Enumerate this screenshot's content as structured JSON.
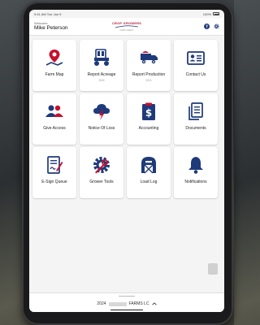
{
  "status_bar": {
    "time": "9:41 AM  Tue Jan 9",
    "battery": "100%"
  },
  "header": {
    "welcome_label": "Welcome",
    "user_name": "Mike Peterson",
    "logo_text": "CROP GROWERS",
    "logo_sub": "FARM CREDIT"
  },
  "tiles": [
    {
      "label": "Farm Map",
      "sub": "",
      "icon": "map-pin-icon"
    },
    {
      "label": "Report Acreage",
      "sub": "2024",
      "icon": "tractor-icon"
    },
    {
      "label": "Report Production",
      "sub": "2024",
      "icon": "truck-icon"
    },
    {
      "label": "Contact Us",
      "sub": "",
      "icon": "contact-card-icon"
    },
    {
      "label": "Give Access",
      "sub": "",
      "icon": "users-icon"
    },
    {
      "label": "Notice Of Loss",
      "sub": "",
      "icon": "storm-cloud-icon"
    },
    {
      "label": "Accounting",
      "sub": "",
      "icon": "dollar-clipboard-icon"
    },
    {
      "label": "Documents",
      "sub": "",
      "icon": "documents-icon"
    },
    {
      "label": "E-Sign Queue",
      "sub": "",
      "icon": "esign-icon"
    },
    {
      "label": "Grower Tools",
      "sub": "",
      "icon": "tools-gear-icon"
    },
    {
      "label": "Load Log",
      "sub": "",
      "icon": "barn-icon"
    },
    {
      "label": "Notifications",
      "sub": "",
      "icon": "bell-icon"
    }
  ],
  "footer": {
    "year": "2024",
    "farm": "FARMS LC"
  },
  "colors": {
    "primary": "#1f3a7a",
    "accent": "#c8102e",
    "background": "#f4f4f4"
  }
}
